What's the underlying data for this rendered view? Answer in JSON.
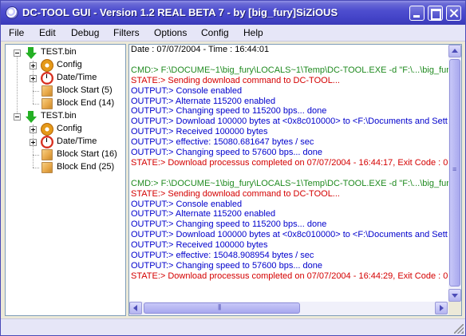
{
  "window": {
    "title": "DC-TOOL GUI - Version 1.2 REAL BETA 7 - by [big_fury]SiZiOUS"
  },
  "menu": [
    {
      "label": "File"
    },
    {
      "label": "Edit"
    },
    {
      "label": "Debug"
    },
    {
      "label": "Filters"
    },
    {
      "label": "Options"
    },
    {
      "label": "Config"
    },
    {
      "label": "Help"
    }
  ],
  "tree": {
    "nodes": [
      {
        "label": "TEST.bin",
        "icon": "download-arrow-icon"
      },
      {
        "label": "Config",
        "icon": "gear-icon"
      },
      {
        "label": "Date/Time",
        "icon": "clock-icon"
      },
      {
        "label": "Block Start (5)",
        "icon": "box-icon"
      },
      {
        "label": "Block End (14)",
        "icon": "box-icon"
      },
      {
        "label": "TEST.bin",
        "icon": "download-arrow-icon"
      },
      {
        "label": "Config",
        "icon": "gear-icon"
      },
      {
        "label": "Date/Time",
        "icon": "clock-icon"
      },
      {
        "label": "Block Start (16)",
        "icon": "box-icon"
      },
      {
        "label": "Block End (25)",
        "icon": "box-icon"
      }
    ]
  },
  "colors": {
    "cmd": "#1f8a1f",
    "state": "#d40000",
    "output": "#0000cc",
    "neutral": "#000000"
  },
  "log": {
    "lines": [
      {
        "text": "Date : 07/07/2004 - Time : 16:44:01",
        "kind": "neutral"
      },
      {
        "text": "",
        "kind": "neutral"
      },
      {
        "text": "CMD:> F:\\DOCUME~1\\big_fury\\LOCALS~1\\Temp\\DC-TOOL.EXE -d \"F:\\...\\big_fury",
        "kind": "cmd"
      },
      {
        "text": "STATE:> Sending download command to DC-TOOL...",
        "kind": "state"
      },
      {
        "text": "OUTPUT:> Console enabled",
        "kind": "output"
      },
      {
        "text": "OUTPUT:> Alternate 115200 enabled",
        "kind": "output"
      },
      {
        "text": "OUTPUT:> Changing speed to 115200 bps... done",
        "kind": "output"
      },
      {
        "text": "OUTPUT:> Download 100000 bytes at <0x8c010000> to <F:\\Documents and Sett",
        "kind": "output"
      },
      {
        "text": "OUTPUT:> Received 100000 bytes",
        "kind": "output"
      },
      {
        "text": "OUTPUT:> effective: 15080.681647 bytes / sec",
        "kind": "output"
      },
      {
        "text": "OUTPUT:> Changing speed to 57600 bps... done",
        "kind": "output"
      },
      {
        "text": "STATE:> Download processus completed on 07/07/2004 - 16:44:17, Exit Code : 0",
        "kind": "state"
      },
      {
        "text": "",
        "kind": "neutral"
      },
      {
        "text": "CMD:> F:\\DOCUME~1\\big_fury\\LOCALS~1\\Temp\\DC-TOOL.EXE -d \"F:\\...\\big_fury",
        "kind": "cmd"
      },
      {
        "text": "STATE:> Sending download command to DC-TOOL...",
        "kind": "state"
      },
      {
        "text": "OUTPUT:> Console enabled",
        "kind": "output"
      },
      {
        "text": "OUTPUT:> Alternate 115200 enabled",
        "kind": "output"
      },
      {
        "text": "OUTPUT:> Changing speed to 115200 bps... done",
        "kind": "output"
      },
      {
        "text": "OUTPUT:> Download 100000 bytes at <0x8c010000> to <F:\\Documents and Sett",
        "kind": "output"
      },
      {
        "text": "OUTPUT:> Received 100000 bytes",
        "kind": "output"
      },
      {
        "text": "OUTPUT:> effective: 15048.908954 bytes / sec",
        "kind": "output"
      },
      {
        "text": "OUTPUT:> Changing speed to 57600 bps... done",
        "kind": "output"
      },
      {
        "text": "STATE:> Download processus completed on 07/07/2004 - 16:44:29, Exit Code : 0",
        "kind": "state"
      }
    ]
  }
}
